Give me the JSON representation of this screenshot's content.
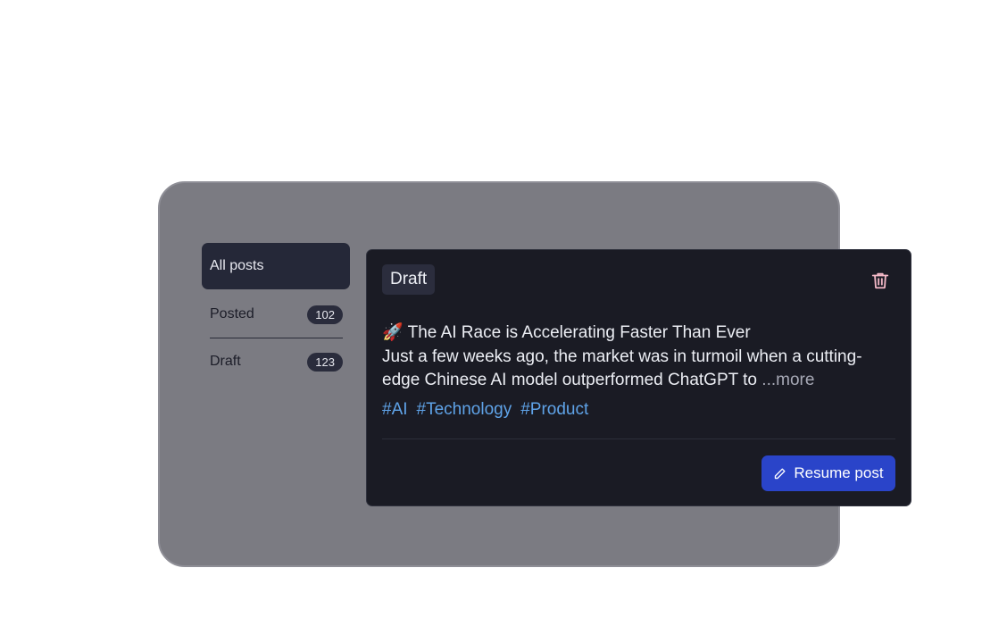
{
  "sidebar": {
    "items": [
      {
        "label": "All posts"
      },
      {
        "label": "Posted",
        "count": "102"
      },
      {
        "label": "Draft",
        "count": "123"
      }
    ]
  },
  "post": {
    "status": "Draft",
    "emoji": "🚀",
    "title": "The AI Race is Accelerating Faster Than Ever",
    "excerpt": "Just a few weeks ago, the market was in turmoil when a cutting-edge Chinese AI model outperformed ChatGPT to",
    "more_label": "...more",
    "hashtags": [
      "#AI",
      "#Technology",
      "#Product"
    ],
    "resume_label": "Resume post",
    "delete_icon": "trash-icon",
    "resume_icon": "pencil-icon"
  },
  "colors": {
    "panel": "#7b7b82",
    "card": "#1a1b24",
    "accent": "#2a44c9",
    "hashtag": "#5fa3e8",
    "delete": "#f2b8c6"
  }
}
